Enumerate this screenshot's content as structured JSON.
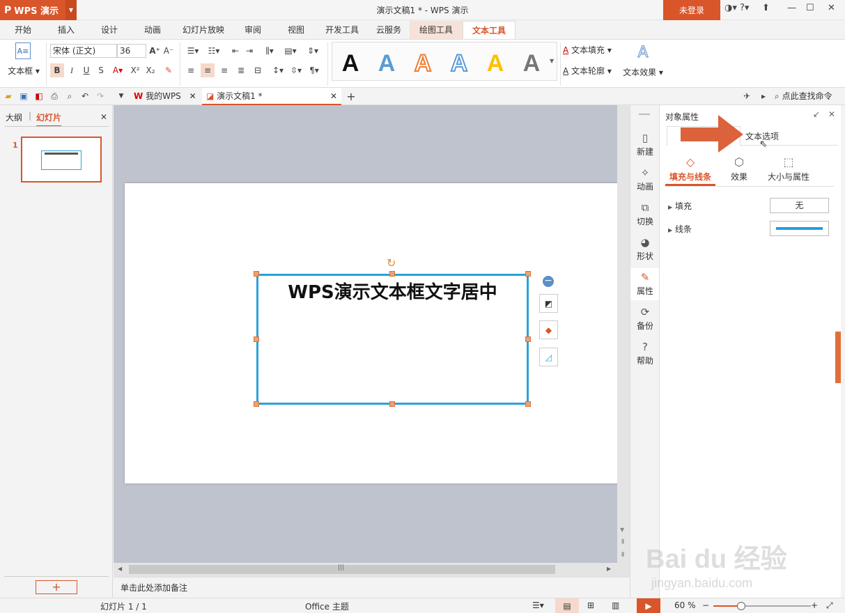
{
  "app": {
    "logo": "P",
    "name": "WPS 演示",
    "title": "演示文稿1 * - WPS 演示",
    "login": "未登录"
  },
  "tabs": [
    "开始",
    "插入",
    "设计",
    "动画",
    "幻灯片放映",
    "审阅",
    "视图",
    "开发工具",
    "云服务",
    "绘图工具",
    "文本工具"
  ],
  "ribbon": {
    "textbox_label": "文本框",
    "font_name": "宋体 (正文)",
    "font_size": "36",
    "text_fill": "文本填充",
    "text_outline": "文本轮廓",
    "text_effect": "文本效果",
    "style_letter": "A"
  },
  "quickbar": {
    "tab_mywps": "我的WPS",
    "tab_doc": "演示文稿1 *",
    "search": "点此查找命令",
    "plus": "+"
  },
  "leftpanel": {
    "tab_outline": "大纲",
    "tab_slides": "幻灯片",
    "slide_number": "1",
    "add": "+"
  },
  "slide": {
    "text": "WPS演示文本框文字居中"
  },
  "notes": "单击此处添加备注",
  "sidebar": [
    "新建",
    "动画",
    "切换",
    "形状",
    "属性",
    "备份",
    "帮助"
  ],
  "propanel": {
    "title": "对象属性",
    "tab_text": "文本选项",
    "subtabs": [
      "填充与线条",
      "效果",
      "大小与属性"
    ],
    "fill_label": "填充",
    "fill_value": "无",
    "line_label": "线条",
    "line_color": "#1ea0e0"
  },
  "status": {
    "slide_info": "幻灯片 1 / 1",
    "theme": "Office 主题",
    "zoom": "60 %"
  },
  "watermark": {
    "brand": "Bai du 经验",
    "url": "jingyan.baidu.com"
  },
  "colors": {
    "accent": "#d9552a",
    "selection": "#2aa3d8"
  }
}
